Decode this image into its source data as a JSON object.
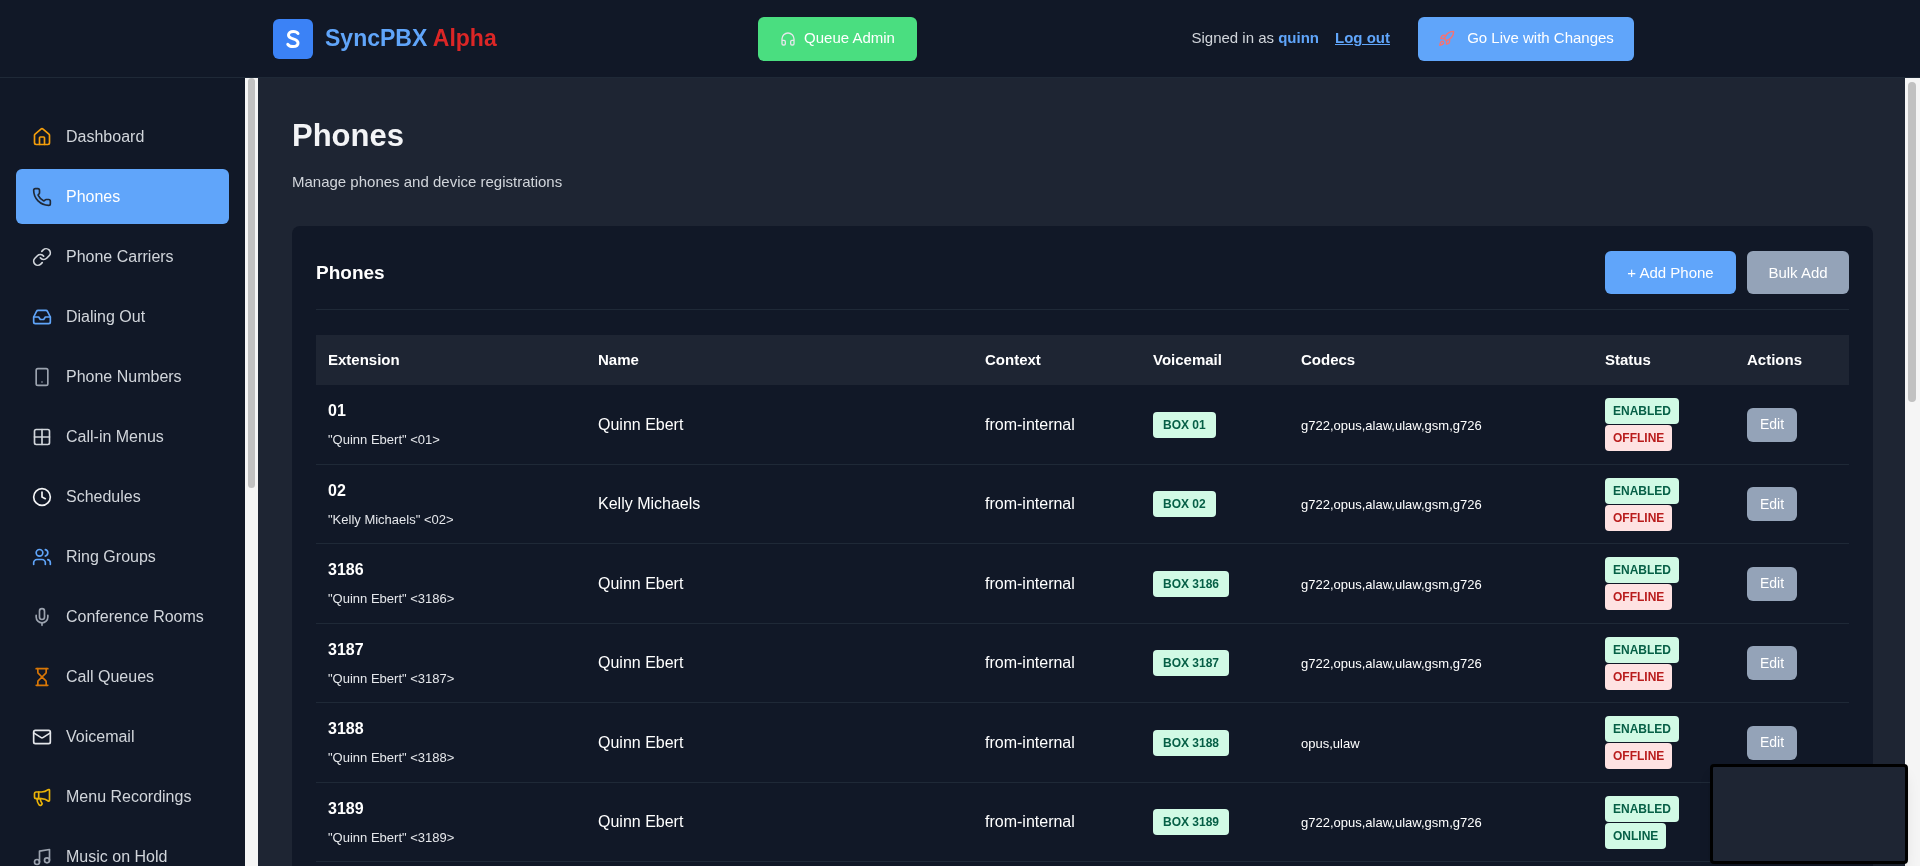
{
  "header": {
    "brand": "SyncPBX",
    "brand_tag": "Alpha",
    "queue_button": "Queue Admin",
    "signed_in_prefix": "Signed in as",
    "user": "quinn",
    "logout": "Log out",
    "go_live_button": "Go Live with Changes"
  },
  "sidebar": {
    "items": [
      {
        "label": "Dashboard",
        "selected": false
      },
      {
        "label": "Phones",
        "selected": true
      },
      {
        "label": "Phone Carriers",
        "selected": false
      },
      {
        "label": "Dialing Out",
        "selected": false
      },
      {
        "label": "Phone Numbers",
        "selected": false
      },
      {
        "label": "Call-in Menus",
        "selected": false
      },
      {
        "label": "Schedules",
        "selected": false
      },
      {
        "label": "Ring Groups",
        "selected": false
      },
      {
        "label": "Conference Rooms",
        "selected": false
      },
      {
        "label": "Call Queues",
        "selected": false
      },
      {
        "label": "Voicemail",
        "selected": false
      },
      {
        "label": "Menu Recordings",
        "selected": false
      },
      {
        "label": "Music on Hold",
        "selected": false
      }
    ]
  },
  "page": {
    "title": "Phones",
    "subtitle": "Manage phones and device registrations"
  },
  "card": {
    "title": "Phones",
    "add_button": "+ Add Phone",
    "bulk_button": "Bulk Add"
  },
  "table": {
    "columns": [
      "Extension",
      "Name",
      "Context",
      "Voicemail",
      "Codecs",
      "Status",
      "Actions"
    ],
    "rows": [
      {
        "extension": "01",
        "caller_id": "\"Quinn Ebert\" <01>",
        "name": "Quinn Ebert",
        "context": "from-internal",
        "voicemail": "BOX 01",
        "codecs": "g722,opus,alaw,ulaw,gsm,g726",
        "enabled": true,
        "enabled_label": "ENABLED",
        "online": false,
        "online_label": "OFFLINE",
        "action": "Edit"
      },
      {
        "extension": "02",
        "caller_id": "\"Kelly Michaels\" <02>",
        "name": "Kelly Michaels",
        "context": "from-internal",
        "voicemail": "BOX 02",
        "codecs": "g722,opus,alaw,ulaw,gsm,g726",
        "enabled": true,
        "enabled_label": "ENABLED",
        "online": false,
        "online_label": "OFFLINE",
        "action": "Edit"
      },
      {
        "extension": "3186",
        "caller_id": "\"Quinn Ebert\" <3186>",
        "name": "Quinn Ebert",
        "context": "from-internal",
        "voicemail": "BOX 3186",
        "codecs": "g722,opus,alaw,ulaw,gsm,g726",
        "enabled": true,
        "enabled_label": "ENABLED",
        "online": false,
        "online_label": "OFFLINE",
        "action": "Edit"
      },
      {
        "extension": "3187",
        "caller_id": "\"Quinn Ebert\" <3187>",
        "name": "Quinn Ebert",
        "context": "from-internal",
        "voicemail": "BOX 3187",
        "codecs": "g722,opus,alaw,ulaw,gsm,g726",
        "enabled": true,
        "enabled_label": "ENABLED",
        "online": false,
        "online_label": "OFFLINE",
        "action": "Edit"
      },
      {
        "extension": "3188",
        "caller_id": "\"Quinn Ebert\" <3188>",
        "name": "Quinn Ebert",
        "context": "from-internal",
        "voicemail": "BOX 3188",
        "codecs": "opus,ulaw",
        "enabled": true,
        "enabled_label": "ENABLED",
        "online": false,
        "online_label": "OFFLINE",
        "action": "Edit"
      },
      {
        "extension": "3189",
        "caller_id": "\"Quinn Ebert\" <3189>",
        "name": "Quinn Ebert",
        "context": "from-internal",
        "voicemail": "BOX 3189",
        "codecs": "g722,opus,alaw,ulaw,gsm,g726",
        "enabled": true,
        "enabled_label": "ENABLED",
        "online": true,
        "online_label": "ONLINE"
      }
    ]
  }
}
